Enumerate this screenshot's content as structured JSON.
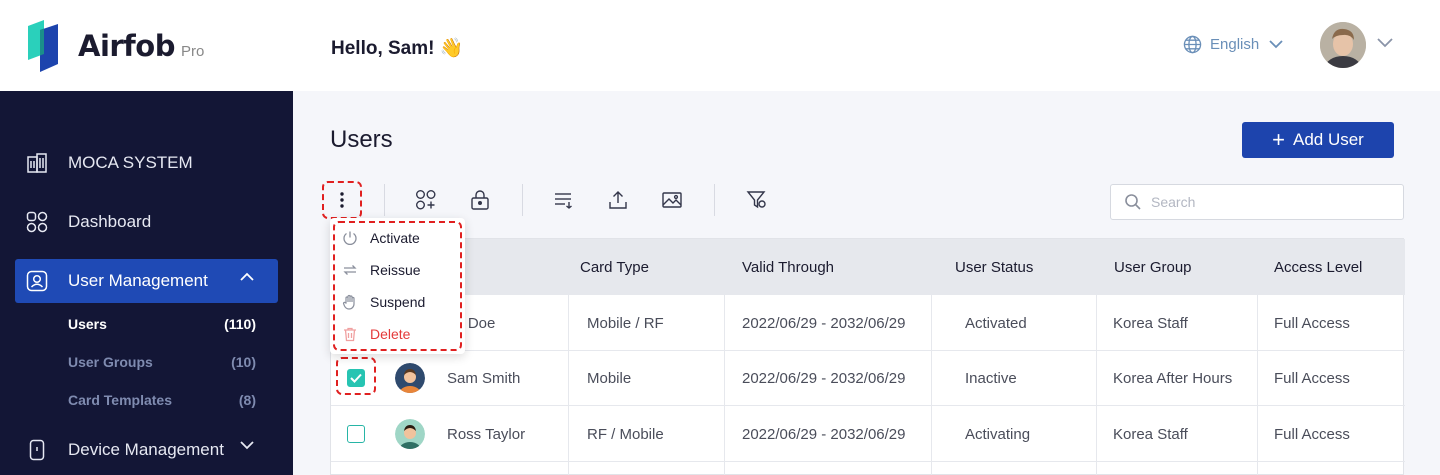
{
  "brand": {
    "name": "Airfob",
    "edition": "Pro"
  },
  "header": {
    "greeting": "Hello, Sam! 👋",
    "language": "English"
  },
  "sidebar": {
    "items": [
      {
        "label": "MOCA SYSTEM",
        "icon": "building-icon"
      },
      {
        "label": "Dashboard",
        "icon": "grid-icon"
      },
      {
        "label": "User Management",
        "icon": "user-card-icon",
        "active": true,
        "sub": [
          {
            "label": "Users",
            "count": "(110)",
            "active": true
          },
          {
            "label": "User Groups",
            "count": "(10)"
          },
          {
            "label": "Card Templates",
            "count": "(8)"
          }
        ]
      },
      {
        "label": "Device Management",
        "icon": "device-icon"
      }
    ]
  },
  "page": {
    "title": "Users",
    "add_button": "Add User"
  },
  "search": {
    "placeholder": "Search"
  },
  "menu": {
    "items": [
      {
        "label": "Activate",
        "icon": "power-icon"
      },
      {
        "label": "Reissue",
        "icon": "repeat-icon"
      },
      {
        "label": "Suspend",
        "icon": "hand-icon"
      },
      {
        "label": "Delete",
        "icon": "trash-icon",
        "danger": true
      }
    ]
  },
  "table": {
    "columns": [
      "Card Type",
      "Valid Through",
      "User Status",
      "User Group",
      "Access Level"
    ],
    "rows": [
      {
        "name": "hn Doe",
        "card_type": "Mobile / RF",
        "valid": "2022/06/29 - 2032/06/29",
        "status": "Activated",
        "group": "Korea Staff",
        "access": "Full Access",
        "checked": false
      },
      {
        "name": "Sam Smith",
        "card_type": "Mobile",
        "valid": "2022/06/29 - 2032/06/29",
        "status": "Inactive",
        "group": "Korea After Hours",
        "access": "Full Access",
        "checked": true
      },
      {
        "name": "Ross Taylor",
        "card_type": "RF / Mobile",
        "valid": "2022/06/29 - 2032/06/29",
        "status": "Activating",
        "group": "Korea Staff",
        "access": "Full Access",
        "checked": false
      }
    ]
  },
  "colors": {
    "primary": "#1d44ad",
    "sidebar": "#131636",
    "accent": "#27c4b2",
    "danger": "#e43a3a"
  }
}
